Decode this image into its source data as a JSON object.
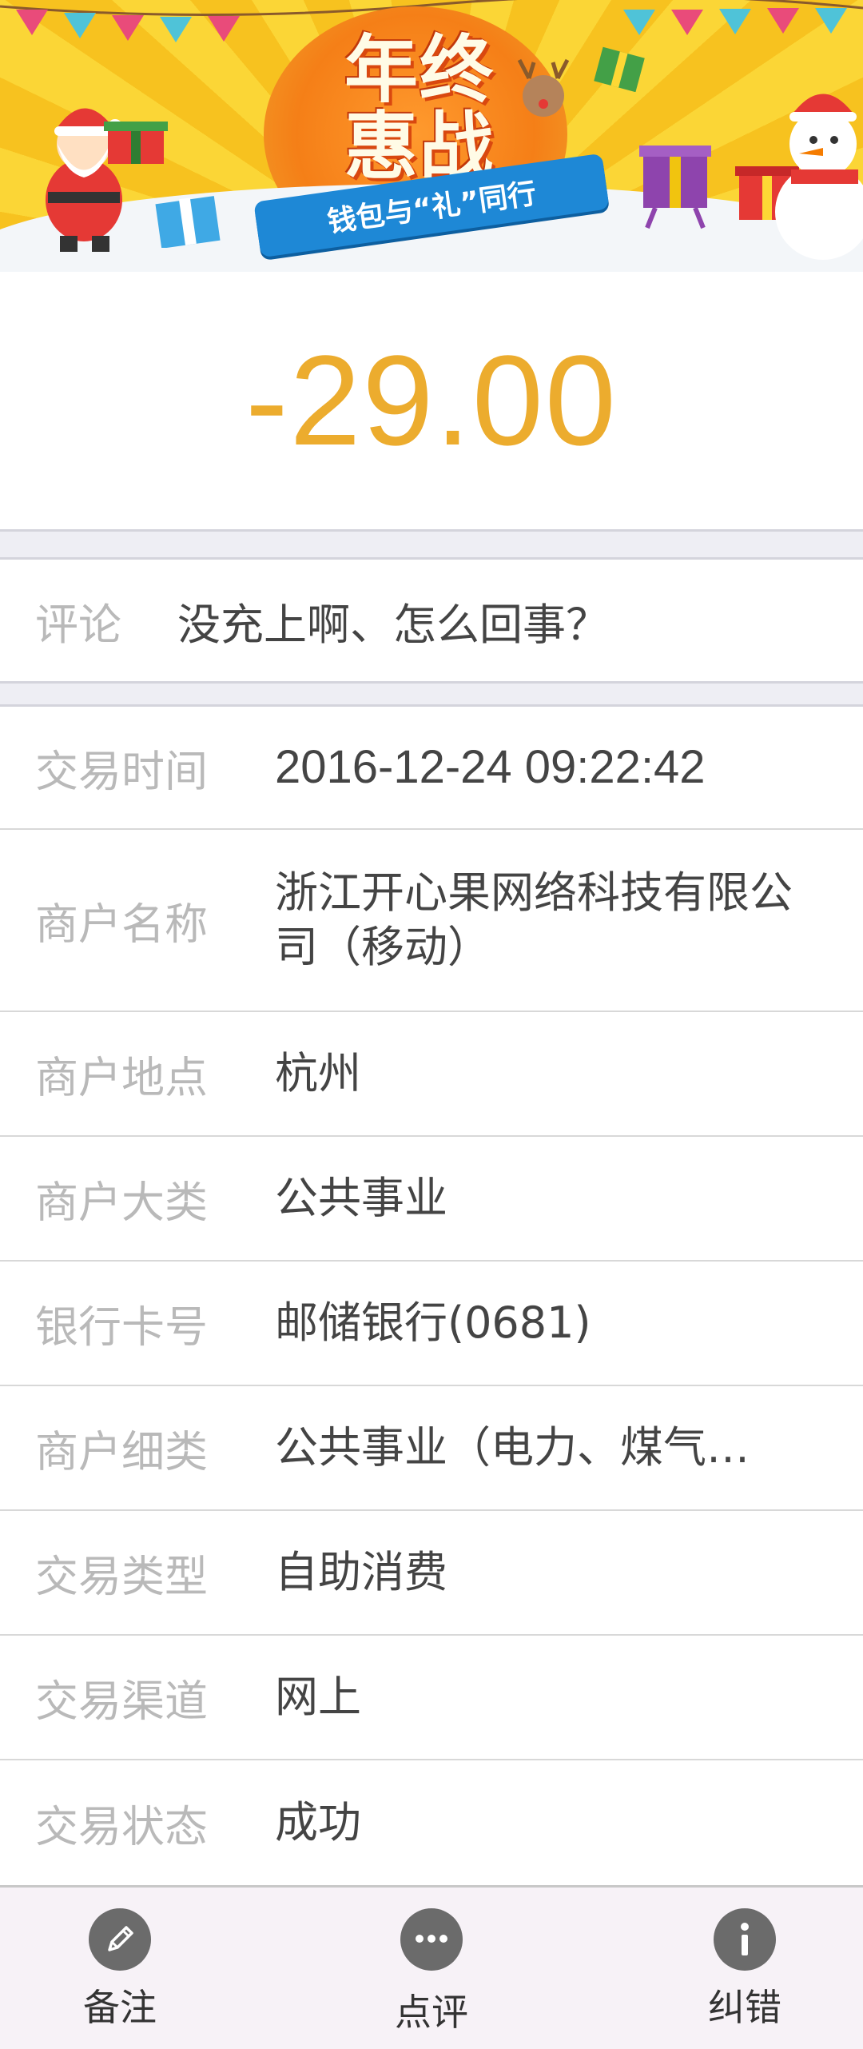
{
  "banner": {
    "title": "年终惠战",
    "subtitle": "钱包与“礼”同行"
  },
  "amount": "-29.00",
  "comment": {
    "label": "评论",
    "value": "没充上啊、怎么回事？"
  },
  "details": [
    {
      "label": "交易时间",
      "value": "2016-12-24 09:22:42"
    },
    {
      "label": "商户名称",
      "value": "浙江开心果网络科技有限公司（移动）"
    },
    {
      "label": "商户地点",
      "value": "杭州"
    },
    {
      "label": "商户大类",
      "value": "公共事业"
    },
    {
      "label": "银行卡号",
      "value": "邮储银行(0681)"
    },
    {
      "label": "商户细类",
      "value": "公共事业（电力、煤气…"
    },
    {
      "label": "交易类型",
      "value": "自助消费"
    },
    {
      "label": "交易渠道",
      "value": "网上"
    },
    {
      "label": "交易状态",
      "value": "成功"
    }
  ],
  "tabbar": {
    "remark": {
      "label": "备注",
      "icon": "pencil-icon"
    },
    "review": {
      "label": "点评",
      "icon": "chat-bubble-icon"
    },
    "correct": {
      "label": "纠错",
      "icon": "info-icon"
    }
  },
  "colors": {
    "amount": "#ecac2e",
    "label": "#b9b9b9",
    "value": "#444444",
    "tab_icon": "#6b6b6b"
  }
}
